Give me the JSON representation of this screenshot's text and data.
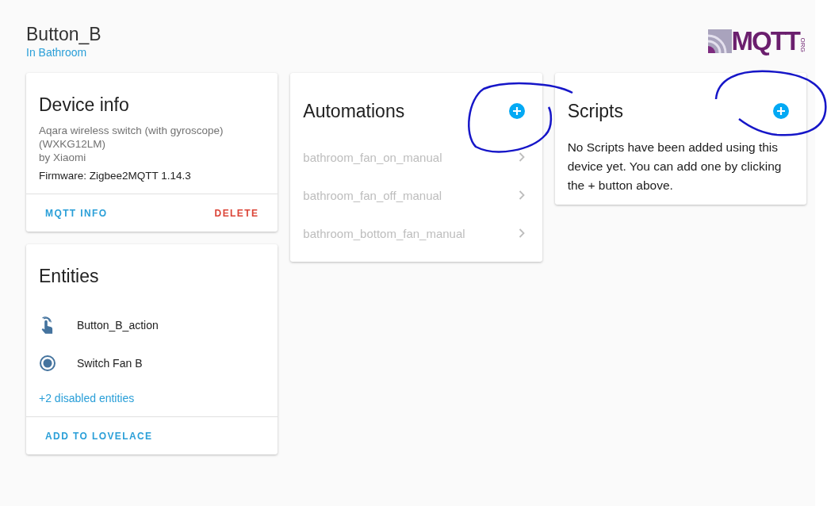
{
  "header": {
    "title": "Button_B",
    "area": "In Bathroom"
  },
  "logo": {
    "text": "MQTT",
    "suffix": "ORG"
  },
  "device_info": {
    "title": "Device info",
    "model": "Aqara wireless switch (with gyroscope)",
    "model_id": "(WXKG12LM)",
    "manufacturer": "by Xiaomi",
    "firmware": "Firmware: Zigbee2MQTT 1.14.3",
    "actions": [
      {
        "label": "MQTT INFO",
        "kind": "primary"
      },
      {
        "label": "DELETE",
        "kind": "danger"
      }
    ]
  },
  "entities": {
    "title": "Entities",
    "items": [
      {
        "name": "Button_B_action",
        "kind": "button"
      },
      {
        "name": "Switch Fan B",
        "kind": "switch"
      }
    ],
    "disabled_link": "+2 disabled entities",
    "action": "ADD TO LOVELACE"
  },
  "automations": {
    "title": "Automations",
    "items": [
      {
        "name": "bathroom_fan_on_manual",
        "disabled": true
      },
      {
        "name": "bathroom_fan_off_manual",
        "disabled": true
      },
      {
        "name": "bathroom_bottom_fan_manual",
        "disabled": true
      }
    ]
  },
  "scripts": {
    "title": "Scripts",
    "message": "No Scripts have been added using this device yet. You can add one by clicking the + button above."
  }
}
